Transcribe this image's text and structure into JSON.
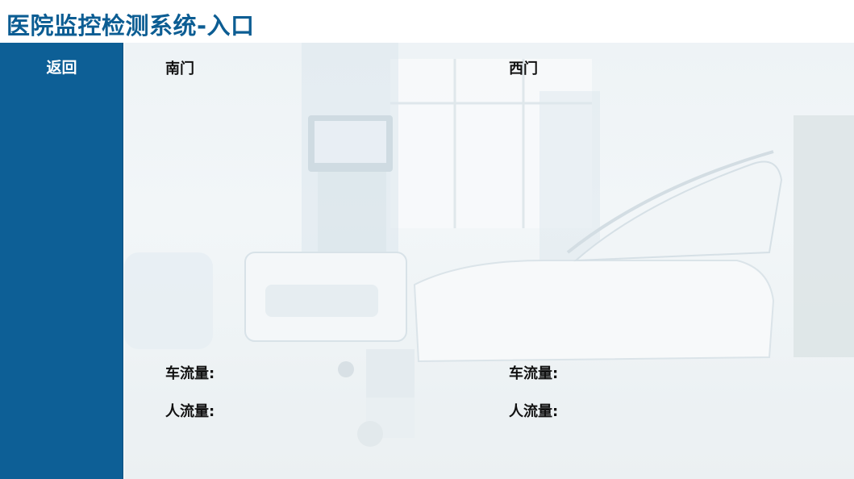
{
  "header": {
    "title": "医院监控检测系统-入口"
  },
  "sidebar": {
    "back_label": "返回"
  },
  "panels": [
    {
      "title": "南门",
      "car_flow_label": "车流量:",
      "people_flow_label": "人流量:"
    },
    {
      "title": "西门",
      "car_flow_label": "车流量:",
      "people_flow_label": "人流量:"
    }
  ],
  "colors": {
    "brand": "#0c5d93",
    "sidebar": "#0d5f96",
    "text": "#111111"
  }
}
